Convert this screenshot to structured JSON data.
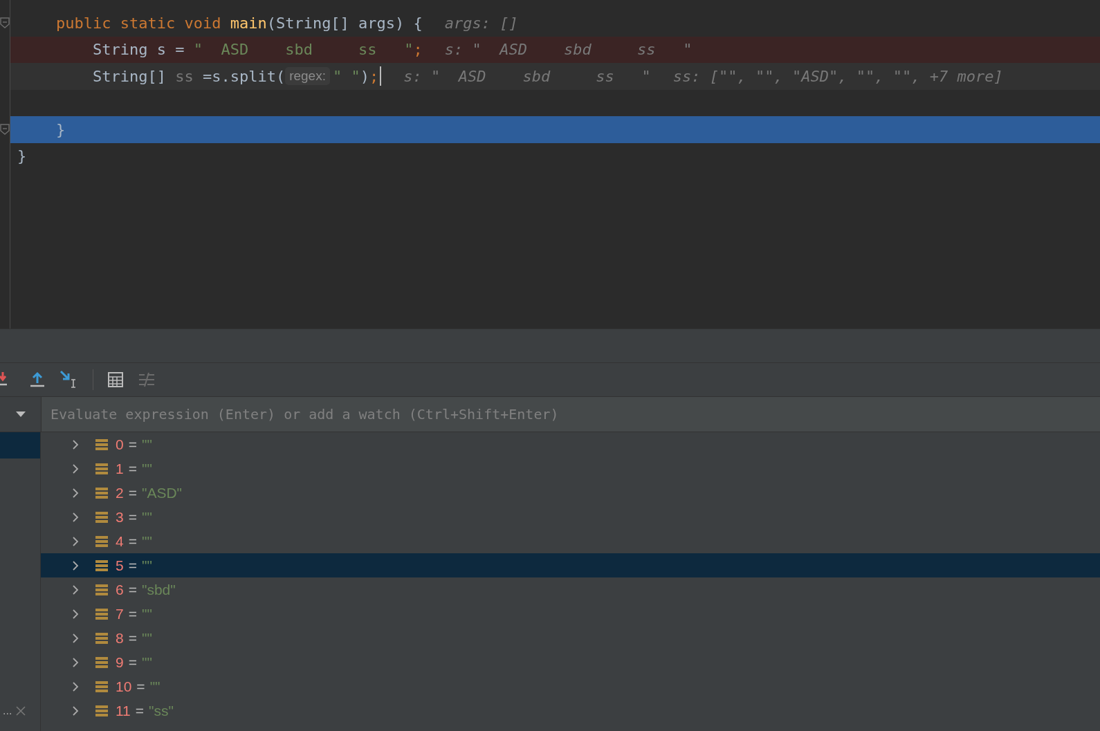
{
  "editor": {
    "lines": [
      {
        "kind": "plain",
        "fold": true,
        "tokens": [
          {
            "kind": "keyword",
            "text": "public static void "
          },
          {
            "kind": "method",
            "text": "main"
          },
          {
            "kind": "plain",
            "text": "(String[] args) {"
          },
          {
            "kind": "hint",
            "text": "args: []"
          }
        ]
      },
      {
        "kind": "breakpoint",
        "fold": false,
        "tokens": [
          {
            "kind": "plain",
            "text": "    String s = "
          },
          {
            "kind": "string",
            "text": "\"  ASD    sbd     ss   \""
          },
          {
            "kind": "keyword",
            "text": ";"
          },
          {
            "kind": "hint",
            "text": "s: \"  ASD    sbd     ss   \""
          }
        ]
      },
      {
        "kind": "caret",
        "fold": false,
        "tokens": [
          {
            "kind": "plain",
            "text": "    String[] "
          },
          {
            "kind": "unused",
            "text": "ss"
          },
          {
            "kind": "plain",
            "text": " =s.split("
          },
          {
            "kind": "param",
            "text": "regex:"
          },
          {
            "kind": "string",
            "text": "\" \""
          },
          {
            "kind": "plain",
            "text": ")"
          },
          {
            "kind": "keyword",
            "text": ";"
          },
          {
            "kind": "cursor"
          },
          {
            "kind": "hint",
            "text": "s: \"  ASD    sbd     ss   \""
          },
          {
            "kind": "hint",
            "text": "ss: [\"\", \"\", \"ASD\", \"\", \"\", +7 more]"
          }
        ]
      },
      {
        "kind": "plain",
        "fold": false
      },
      {
        "kind": "execution",
        "fold": true,
        "tokens": [
          {
            "kind": "plain",
            "text": "}"
          }
        ]
      },
      {
        "kind": "outer",
        "fold": false,
        "tokens": [
          {
            "kind": "plain",
            "text": "}"
          }
        ]
      }
    ]
  },
  "evaluate": {
    "placeholder": "Evaluate expression (Enter) or add a watch (Ctrl+Shift+Enter)"
  },
  "variables": [
    {
      "index": "0",
      "separator": "=",
      "value": "\"\"",
      "selected": false
    },
    {
      "index": "1",
      "separator": "=",
      "value": "\"\"",
      "selected": false
    },
    {
      "index": "2",
      "separator": "=",
      "value": "\"ASD\"",
      "selected": false
    },
    {
      "index": "3",
      "separator": "=",
      "value": "\"\"",
      "selected": false
    },
    {
      "index": "4",
      "separator": "=",
      "value": "\"\"",
      "selected": false
    },
    {
      "index": "5",
      "separator": "=",
      "value": "\"\"",
      "selected": true
    },
    {
      "index": "6",
      "separator": "=",
      "value": "\"sbd\"",
      "selected": false
    },
    {
      "index": "7",
      "separator": "=",
      "value": "\"\"",
      "selected": false
    },
    {
      "index": "8",
      "separator": "=",
      "value": "\"\"",
      "selected": false
    },
    {
      "index": "9",
      "separator": "=",
      "value": "\"\"",
      "selected": false
    },
    {
      "index": "10",
      "separator": "=",
      "value": "\"\"",
      "selected": false
    },
    {
      "index": "11",
      "separator": "=",
      "value": "\"ss\"",
      "selected": false
    }
  ],
  "frames": {
    "ellipsis": "..."
  }
}
